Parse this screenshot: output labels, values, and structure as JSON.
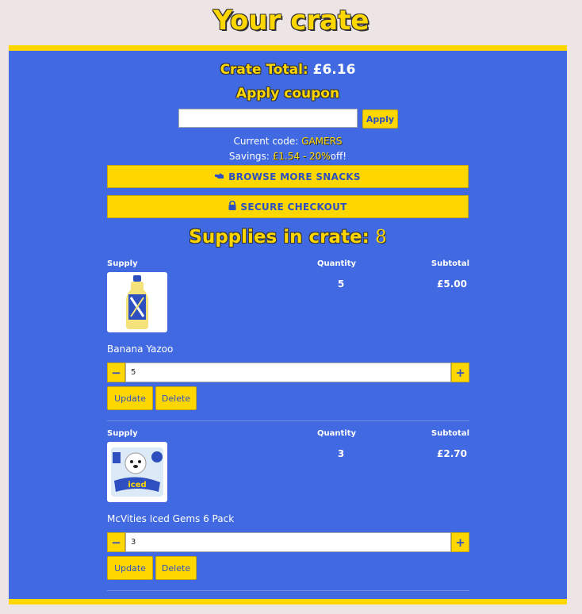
{
  "title": "Your crate",
  "summary": {
    "total_label": "Crate Total:",
    "total_value": "£6.16",
    "coupon_heading": "Apply coupon",
    "coupon_input_value": "",
    "apply_label": "Apply",
    "code_label": "Current code:",
    "code_value": "GAMERS",
    "savings_label": "Savings:",
    "savings_value": "£1.54 - 20%",
    "savings_suffix": "off!",
    "browse_label": "BROWSE MORE SNACKS",
    "checkout_label": "SECURE CHECKOUT",
    "supplies_label": "Supplies in crate:",
    "supplies_count": "8"
  },
  "columns": {
    "supply": "Supply",
    "quantity": "Quantity",
    "subtotal": "Subtotal"
  },
  "items": [
    {
      "name": "Banana Yazoo",
      "quantity": "5",
      "subtotal": "£5.00",
      "input_value": "5",
      "update_label": "Update",
      "delete_label": "Delete"
    },
    {
      "name": "McVities Iced Gems 6 Pack",
      "quantity": "3",
      "subtotal": "£2.70",
      "input_value": "3",
      "update_label": "Update",
      "delete_label": "Delete"
    }
  ],
  "colors": {
    "brand_blue": "#4169e1",
    "accent_yellow": "#ffd700",
    "background": "#ede5e5"
  },
  "icons": {
    "browse": "pointing-hand-icon",
    "checkout": "lock-icon",
    "minus": "minus-icon",
    "plus": "plus-icon"
  }
}
